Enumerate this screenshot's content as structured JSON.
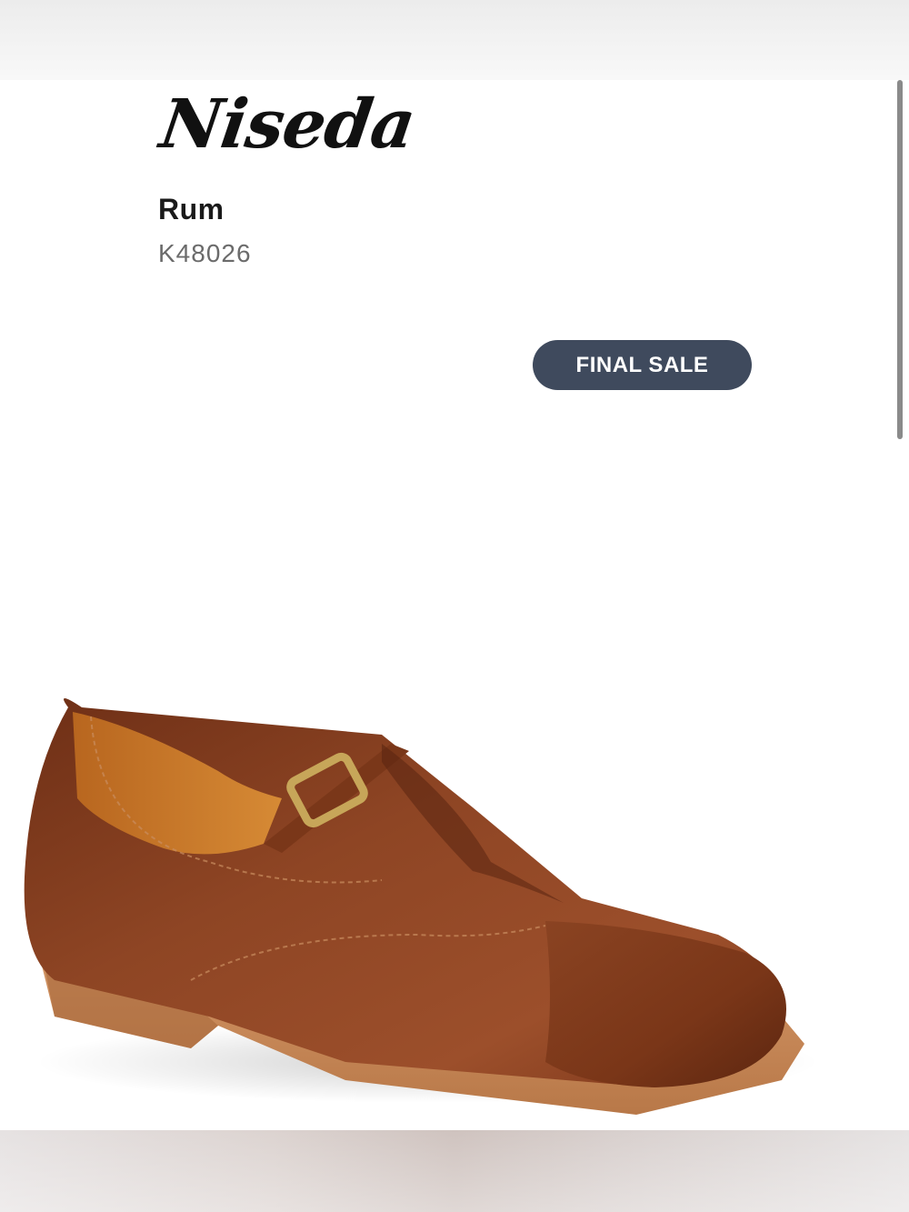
{
  "product": {
    "name": "Niseda",
    "color": "Rum",
    "sku": "K48026",
    "badge": "FINAL SALE",
    "image_alt": "brown leather buckle shoe"
  },
  "colors": {
    "badge_bg": "#3f4a5d",
    "leather": "#8b3f1f",
    "sole": "#c98a5a"
  }
}
